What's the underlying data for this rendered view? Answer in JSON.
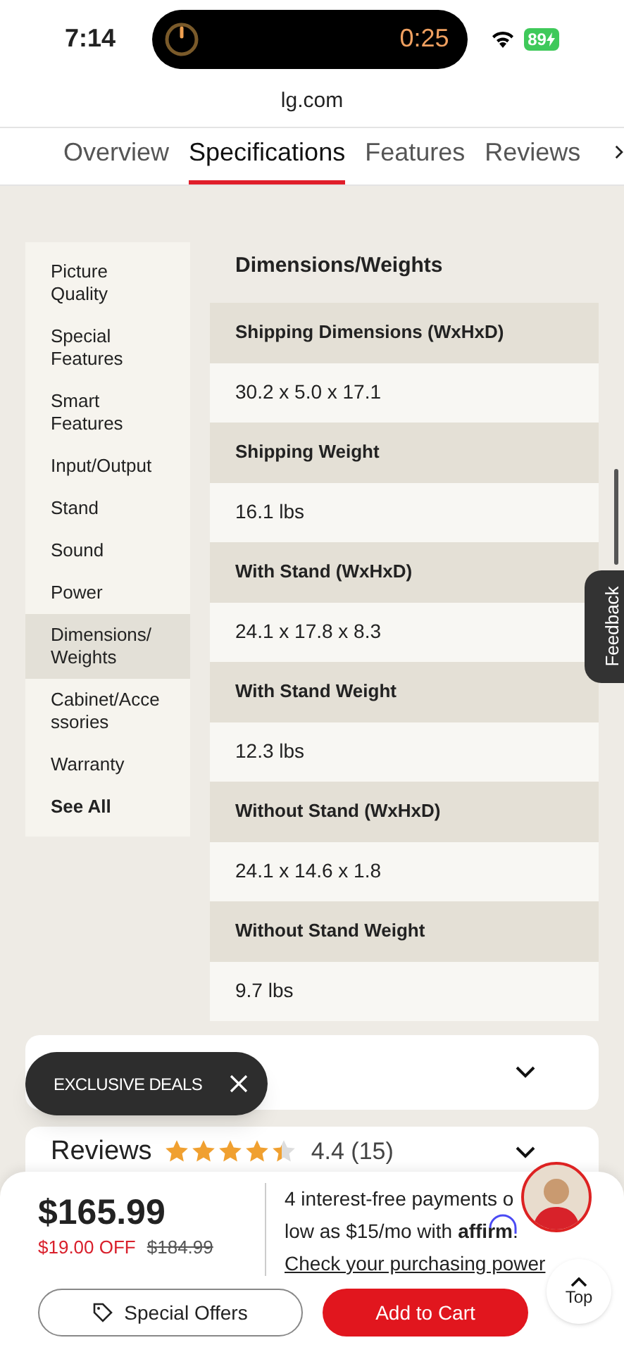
{
  "status_bar": {
    "time": "7:14",
    "timer": "0:25",
    "battery": "89"
  },
  "url_bar": {
    "url": "lg.com"
  },
  "tabs": [
    {
      "label": "Overview",
      "selected": false
    },
    {
      "label": "Specifications",
      "selected": true
    },
    {
      "label": "Features",
      "selected": false
    },
    {
      "label": "Reviews",
      "selected": false
    }
  ],
  "spec_nav": [
    {
      "label": "Picture Quality",
      "selected": false,
      "bold": false
    },
    {
      "label": "Special Features",
      "selected": false,
      "bold": false
    },
    {
      "label": "Smart Features",
      "selected": false,
      "bold": false
    },
    {
      "label": "Input/Output",
      "selected": false,
      "bold": false
    },
    {
      "label": "Stand",
      "selected": false,
      "bold": false
    },
    {
      "label": "Sound",
      "selected": false,
      "bold": false
    },
    {
      "label": "Power",
      "selected": false,
      "bold": false
    },
    {
      "label": "Dimensions/ Weights",
      "selected": true,
      "bold": false
    },
    {
      "label": "Cabinet/Acce ssories",
      "selected": false,
      "bold": false
    },
    {
      "label": "Warranty",
      "selected": false,
      "bold": false
    },
    {
      "label": "See All",
      "selected": false,
      "bold": true
    }
  ],
  "spec_section": {
    "title": "Dimensions/Weights",
    "rows": [
      {
        "label": "Shipping Dimensions (WxHxD)",
        "value": "30.2 x 5.0 x 17.1"
      },
      {
        "label": "Shipping Weight",
        "value": "16.1 lbs"
      },
      {
        "label": "With Stand (WxHxD)",
        "value": "24.1 x 17.8 x 8.3"
      },
      {
        "label": "With Stand Weight",
        "value": "12.3 lbs"
      },
      {
        "label": "Without Stand (WxHxD)",
        "value": "24.1 x 14.6 x 1.8"
      },
      {
        "label": "Without Stand Weight",
        "value": "9.7 lbs"
      }
    ]
  },
  "feedback_tab": {
    "label": "Feedback"
  },
  "exclusive_deals": {
    "label": "EXCLUSIVE DEALS"
  },
  "reviews": {
    "title": "Reviews",
    "stars": 4.4,
    "rating": "4.4 (15)"
  },
  "purchase_bar": {
    "price": "$165.99",
    "discount": "$19.00 OFF",
    "old_price": "$184.99",
    "financing_line1": "4 interest-free payments o",
    "financing_line2": "low as $15/mo with",
    "affirm": "affirm",
    "period": ".",
    "financing_link": "Check your purchasing power",
    "special_offers": "Special Offers",
    "add_to_cart": "Add to Cart",
    "top": "Top"
  }
}
